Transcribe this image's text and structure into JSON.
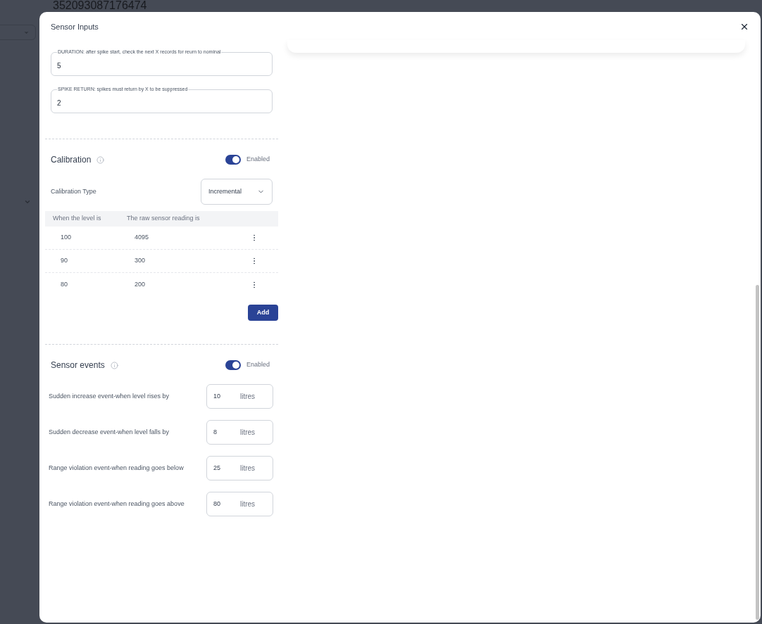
{
  "background": {
    "heading": "352093087176474"
  },
  "dialog": {
    "title": "Sensor Inputs"
  },
  "fields": [
    {
      "label": "DURATION: after spike start, check the next X records for reurn to nominal",
      "value": "5"
    },
    {
      "label": "SPIKE RETURN: spikes must return by X to be suppressed",
      "value": "2"
    }
  ],
  "calibration": {
    "title": "Calibration",
    "enabled": true,
    "toggle_label": "Enabled",
    "type_label": "Calibration Type",
    "type_value": "Incremental",
    "columns": [
      "When the level is",
      "The raw sensor reading is"
    ],
    "rows": [
      {
        "level": "100",
        "reading": "4095"
      },
      {
        "level": "90",
        "reading": "300"
      },
      {
        "level": "80",
        "reading": "200"
      }
    ],
    "add_button": "Add"
  },
  "sensor_events": {
    "title": "Sensor events",
    "enabled": true,
    "toggle_label": "Enabled",
    "events": [
      {
        "label": "Sudden increase event-when level rises by",
        "value": "10",
        "unit": "litres"
      },
      {
        "label": "Sudden decrease event-when level falls by",
        "value": "8",
        "unit": "litres"
      },
      {
        "label": "Range violation event-when reading goes below",
        "value": "25",
        "unit": "litres"
      },
      {
        "label": "Range violation event-when reading goes above",
        "value": "80",
        "unit": "litres"
      }
    ]
  }
}
